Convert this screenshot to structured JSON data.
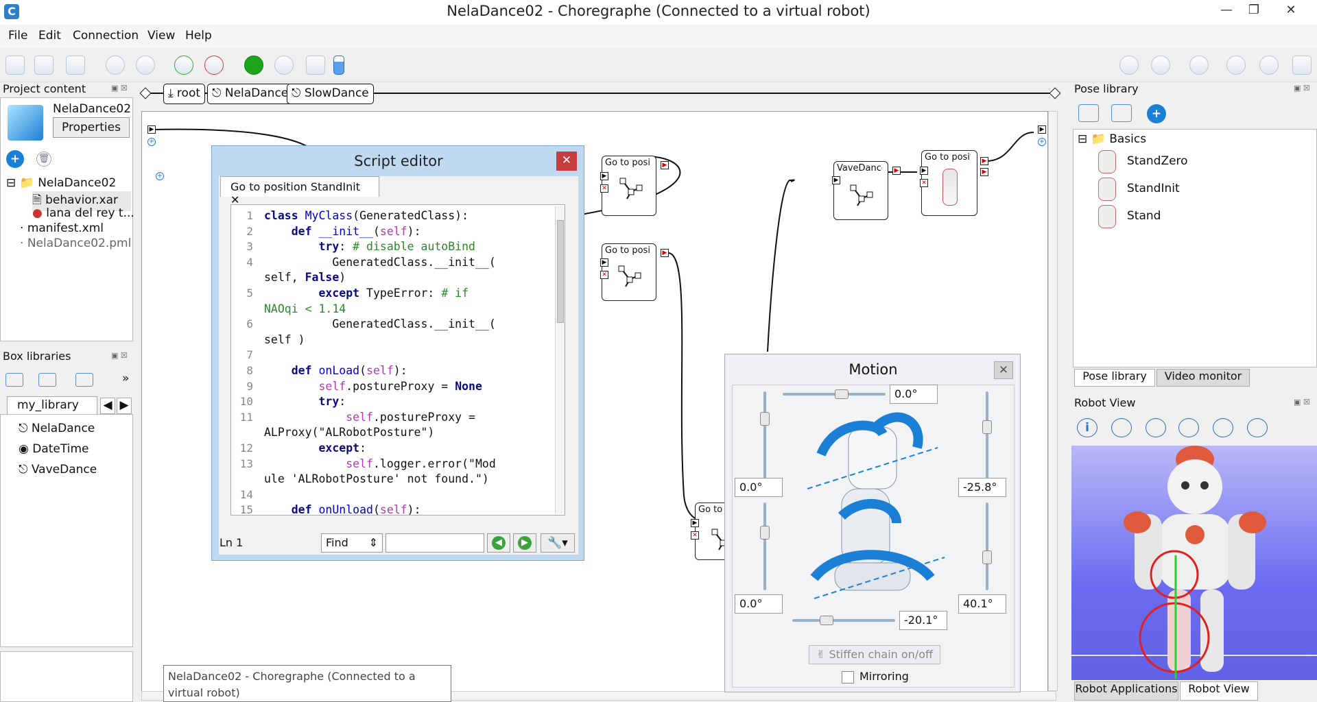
{
  "window": {
    "title": "NelaDance02 - Choregraphe (Connected to a virtual robot)"
  },
  "menu": [
    "File",
    "Edit",
    "Connection",
    "View",
    "Help"
  ],
  "project_content": {
    "header": "Project content",
    "project_name": "NelaDance02",
    "properties_label": "Properties",
    "tree": [
      {
        "label": "NelaDance02",
        "indent": 0
      },
      {
        "label": "behavior.xar",
        "indent": 1
      },
      {
        "label": "lana del rey t...",
        "indent": 1
      },
      {
        "label": "manifest.xml",
        "indent": 0
      },
      {
        "label": "NelaDance02.pml",
        "indent": 0
      }
    ]
  },
  "box_libraries": {
    "header": "Box libraries",
    "more": "»",
    "tab": "my_library",
    "items": [
      "NelaDance",
      "DateTime",
      "VaveDance"
    ]
  },
  "breadcrumb": [
    "root",
    "NelaDance",
    "SlowDance"
  ],
  "flow_boxes": [
    {
      "label": "Go to positic"
    },
    {
      "label": "Go to positic"
    },
    {
      "label": "VaveDance"
    },
    {
      "label": "Go to positic"
    },
    {
      "label": "Go to p"
    }
  ],
  "script_editor": {
    "title": "Script editor",
    "tab": "Go to position StandInit",
    "status_line": "Ln 1",
    "find_label": "Find",
    "lines": [
      {
        "n": "1",
        "segs": [
          [
            "kw",
            "class "
          ],
          [
            "cls",
            "MyClass"
          ],
          [
            "n",
            "(GeneratedClass):"
          ]
        ]
      },
      {
        "n": "2",
        "segs": [
          [
            "n",
            "    "
          ],
          [
            "kw",
            "def "
          ],
          [
            "cls",
            "__init__"
          ],
          [
            "n",
            "("
          ],
          [
            "slf",
            "self"
          ],
          [
            "n",
            "):"
          ]
        ]
      },
      {
        "n": "3",
        "segs": [
          [
            "n",
            "        "
          ],
          [
            "kw",
            "try"
          ],
          [
            "n",
            ": "
          ],
          [
            "cm",
            "# disable autoBind"
          ]
        ]
      },
      {
        "n": "4",
        "segs": [
          [
            "n",
            "          GeneratedClass.__init__("
          ]
        ]
      },
      {
        "n": "",
        "segs": [
          [
            "n",
            "self, "
          ],
          [
            "kw",
            "False"
          ],
          [
            "n",
            ")"
          ]
        ]
      },
      {
        "n": "5",
        "segs": [
          [
            "n",
            "        "
          ],
          [
            "kw",
            "except "
          ],
          [
            "n",
            "TypeError: "
          ],
          [
            "cm",
            "# if"
          ]
        ]
      },
      {
        "n": "",
        "segs": [
          [
            "cm",
            "NAOqi < 1.14"
          ]
        ]
      },
      {
        "n": "6",
        "segs": [
          [
            "n",
            "          GeneratedClass.__init__("
          ]
        ]
      },
      {
        "n": "",
        "segs": [
          [
            "n",
            "self )"
          ]
        ]
      },
      {
        "n": "7",
        "segs": [
          [
            "n",
            ""
          ]
        ]
      },
      {
        "n": "8",
        "segs": [
          [
            "n",
            "    "
          ],
          [
            "kw",
            "def "
          ],
          [
            "cls",
            "onLoad"
          ],
          [
            "n",
            "("
          ],
          [
            "slf",
            "self"
          ],
          [
            "n",
            "):"
          ]
        ]
      },
      {
        "n": "9",
        "segs": [
          [
            "n",
            "        "
          ],
          [
            "slf",
            "self"
          ],
          [
            "n",
            ".postureProxy = "
          ],
          [
            "kw",
            "None"
          ]
        ]
      },
      {
        "n": "10",
        "segs": [
          [
            "n",
            "        "
          ],
          [
            "kw",
            "try"
          ],
          [
            "n",
            ":"
          ]
        ]
      },
      {
        "n": "11",
        "segs": [
          [
            "n",
            "            "
          ],
          [
            "slf",
            "self"
          ],
          [
            "n",
            ".postureProxy ="
          ]
        ]
      },
      {
        "n": "",
        "segs": [
          [
            "n",
            "ALProxy(\"ALRobotPosture\")"
          ]
        ]
      },
      {
        "n": "12",
        "segs": [
          [
            "n",
            "        "
          ],
          [
            "kw",
            "except"
          ],
          [
            "n",
            ":"
          ]
        ]
      },
      {
        "n": "13",
        "segs": [
          [
            "n",
            "            "
          ],
          [
            "slf",
            "self"
          ],
          [
            "n",
            ".logger.error(\"Mod"
          ]
        ]
      },
      {
        "n": "",
        "segs": [
          [
            "n",
            "ule 'ALRobotPosture' not found.\")"
          ]
        ]
      },
      {
        "n": "14",
        "segs": [
          [
            "n",
            ""
          ]
        ]
      },
      {
        "n": "15",
        "segs": [
          [
            "n",
            "    "
          ],
          [
            "kw",
            "def "
          ],
          [
            "cls",
            "onUnload"
          ],
          [
            "n",
            "("
          ],
          [
            "slf",
            "self"
          ],
          [
            "n",
            "):"
          ]
        ]
      }
    ]
  },
  "motion": {
    "title": "Motion",
    "values": {
      "top": "0.0°",
      "left_top": "0.0°",
      "right_top": "-25.8°",
      "left_bottom": "0.0°",
      "right_bottom": "40.1°",
      "bottom": "-20.1°"
    },
    "stiffen_label": "Stiffen chain on/off",
    "mirroring_label": "Mirroring"
  },
  "pose_library": {
    "header": "Pose library",
    "folder": "Basics",
    "poses": [
      "StandZero",
      "StandInit",
      "Stand"
    ],
    "tabs": [
      "Pose library",
      "Video monitor"
    ]
  },
  "robot_view": {
    "header": "Robot View",
    "tabs": [
      "Robot Applications",
      "Robot View"
    ]
  },
  "tooltip": "NelaDance02 - Choregraphe (Connected to a virtual robot)",
  "colors": {
    "accent": "#1c7fd6",
    "play": "#1aa51a",
    "error": "#d00000",
    "robot_bg": "#6b6bf0"
  }
}
